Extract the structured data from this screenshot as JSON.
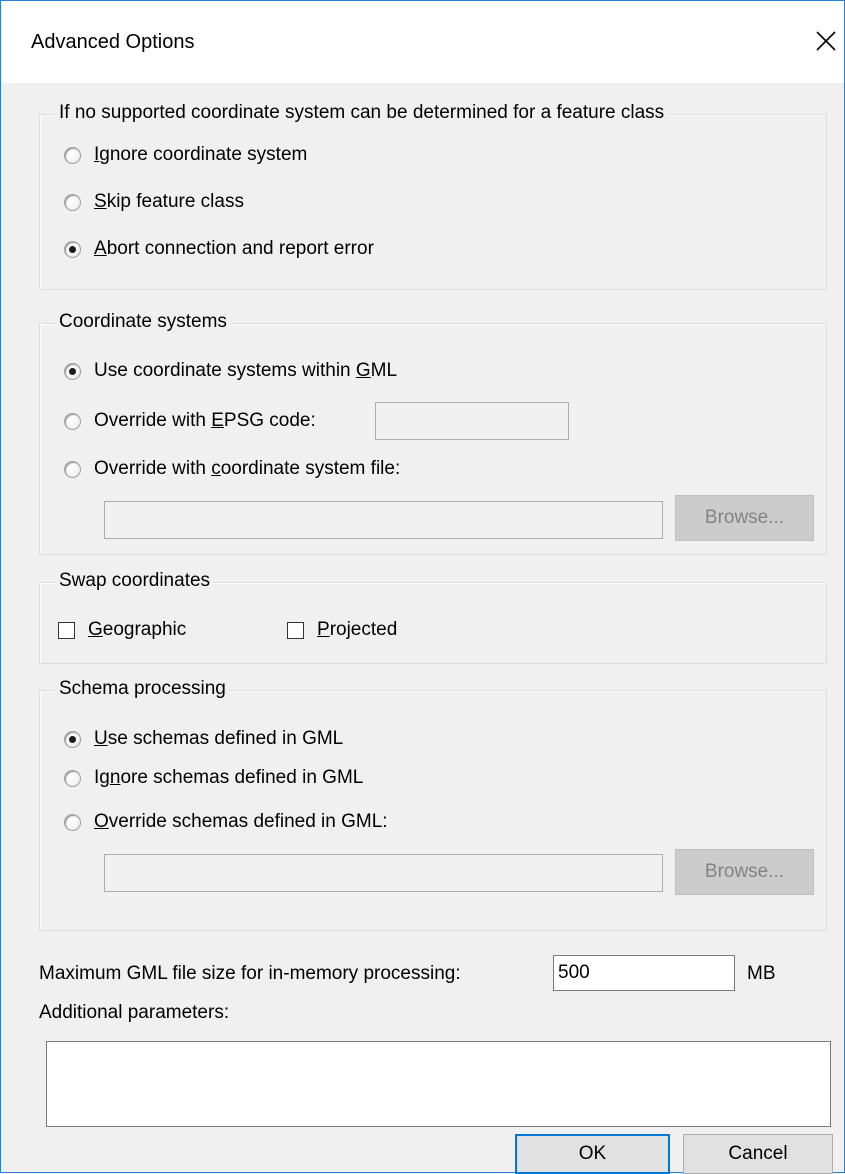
{
  "window": {
    "title": "Advanced Options",
    "close_glyph": "close-icon"
  },
  "unsupported_cs": {
    "legend": "If no supported coordinate system can be determined for a feature class",
    "options": [
      {
        "pre": "",
        "accel": "I",
        "post": "gnore coordinate system",
        "checked": false
      },
      {
        "pre": "",
        "accel": "S",
        "post": "kip feature class",
        "checked": false
      },
      {
        "pre": "",
        "accel": "A",
        "post": "bort connection and report error",
        "checked": true
      }
    ]
  },
  "coordinate_systems": {
    "legend": "Coordinate systems",
    "options": [
      {
        "pre": "Use coordinate systems within ",
        "accel": "G",
        "post": "ML",
        "checked": true
      },
      {
        "pre": "Override with ",
        "accel": "E",
        "post": "PSG code:",
        "checked": false
      },
      {
        "pre": "Override with ",
        "accel": "c",
        "post": "oordinate system file:",
        "checked": false
      }
    ],
    "epsg_value": "",
    "file_value": "",
    "browse_label": "Browse..."
  },
  "swap": {
    "legend": "Swap coordinates",
    "geographic": {
      "pre": "",
      "accel": "G",
      "post": "eographic",
      "checked": false
    },
    "projected": {
      "pre": "",
      "accel": "P",
      "post": "rojected",
      "checked": false
    }
  },
  "schema": {
    "legend": "Schema processing",
    "options": [
      {
        "pre": "",
        "accel": "U",
        "post": "se schemas defined in GML",
        "checked": true
      },
      {
        "pre": "Ig",
        "accel": "n",
        "post": "ore schemas defined in GML",
        "checked": false
      },
      {
        "pre": "",
        "accel": "O",
        "post": "verride schemas defined in GML:",
        "checked": false
      }
    ],
    "file_value": "",
    "browse_label": "Browse..."
  },
  "memory": {
    "label": "Maximum GML file size for in-memory processing:",
    "value": "500",
    "unit": "MB"
  },
  "additional": {
    "label": "Additional parameters:",
    "value": ""
  },
  "buttons": {
    "ok": "OK",
    "cancel": "Cancel"
  }
}
